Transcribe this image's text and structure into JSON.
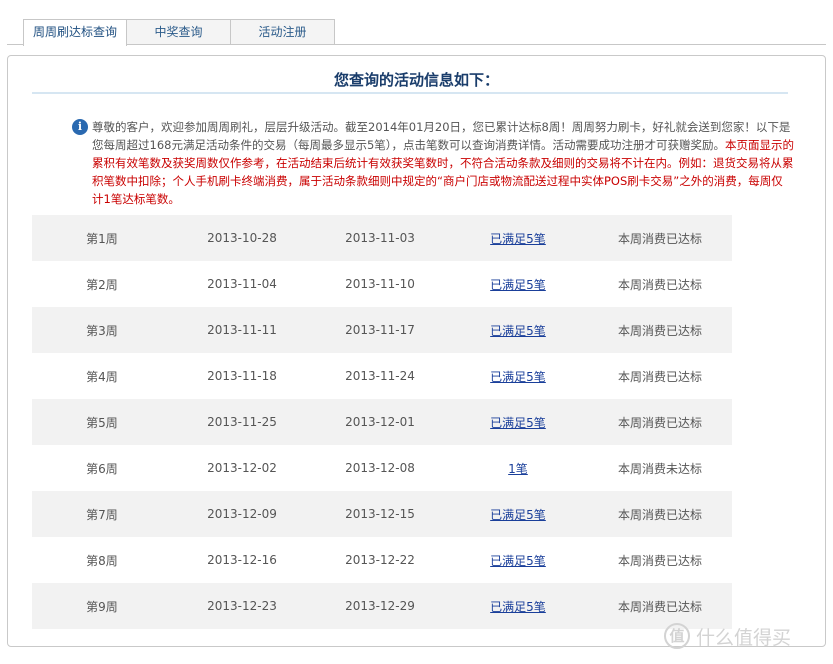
{
  "tabs": [
    {
      "label": "周周刷达标查询",
      "active": true
    },
    {
      "label": "中奖查询",
      "active": false
    },
    {
      "label": "活动注册",
      "active": false
    }
  ],
  "panel": {
    "title": "您查询的活动信息如下："
  },
  "notice": {
    "icon": "info-icon",
    "normal_text": "尊敬的客户，欢迎参加周周刷礼，层层升级活动。截至2014年01月20日，您已累计达标8周！周周努力刷卡，好礼就会送到您家！以下是您每周超过168元满足活动条件的交易（每周最多显示5笔），点击笔数可以查询消费详情。活动需要成功注册才可获赠奖励。",
    "warning_text": "本页面显示的累积有效笔数及获奖周数仅作参考，在活动结束后统计有效获奖笔数时，不符合活动条款及细则的交易将不计在内。例如：退货交易将从累积笔数中扣除；个人手机刷卡终端消费，属于活动条款细则中规定的“商户门店或物流配送过程中实体POS刷卡交易”之外的消费，每周仅计1笔达标笔数。",
    "warning_color": "#c90000"
  },
  "weeks": [
    {
      "week": "第1周",
      "start": "2013-10-28",
      "end": "2013-11-03",
      "count": "已满足5笔",
      "status": "本周消费已达标"
    },
    {
      "week": "第2周",
      "start": "2013-11-04",
      "end": "2013-11-10",
      "count": "已满足5笔",
      "status": "本周消费已达标"
    },
    {
      "week": "第3周",
      "start": "2013-11-11",
      "end": "2013-11-17",
      "count": "已满足5笔",
      "status": "本周消费已达标"
    },
    {
      "week": "第4周",
      "start": "2013-11-18",
      "end": "2013-11-24",
      "count": "已满足5笔",
      "status": "本周消费已达标"
    },
    {
      "week": "第5周",
      "start": "2013-11-25",
      "end": "2013-12-01",
      "count": "已满足5笔",
      "status": "本周消费已达标"
    },
    {
      "week": "第6周",
      "start": "2013-12-02",
      "end": "2013-12-08",
      "count": "1笔",
      "status": "本周消费未达标"
    },
    {
      "week": "第7周",
      "start": "2013-12-09",
      "end": "2013-12-15",
      "count": "已满足5笔",
      "status": "本周消费已达标"
    },
    {
      "week": "第8周",
      "start": "2013-12-16",
      "end": "2013-12-22",
      "count": "已满足5笔",
      "status": "本周消费已达标"
    },
    {
      "week": "第9周",
      "start": "2013-12-23",
      "end": "2013-12-29",
      "count": "已满足5笔",
      "status": "本周消费已达标"
    }
  ],
  "watermark": {
    "logo": "值",
    "text": "什么值得买"
  }
}
